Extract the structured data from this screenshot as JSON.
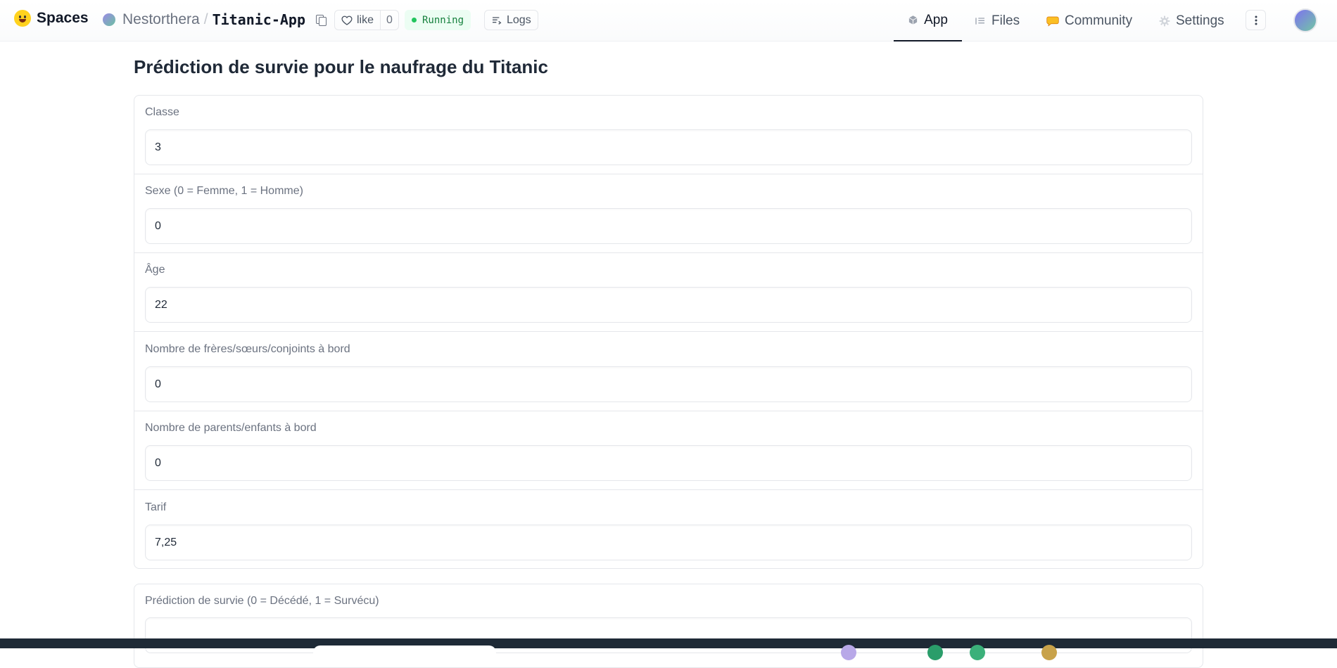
{
  "header": {
    "brand_label": "Spaces",
    "owner": "Nestorthera",
    "separator": "/",
    "repo": "Titanic-App",
    "like_label": "like",
    "like_count": "0",
    "status_label": "Running",
    "logs_label": "Logs",
    "tabs": [
      {
        "label": "App",
        "icon": "cube-icon",
        "active": true
      },
      {
        "label": "Files",
        "icon": "files-icon",
        "active": false
      },
      {
        "label": "Community",
        "icon": "community-icon",
        "active": false
      },
      {
        "label": "Settings",
        "icon": "gear-icon",
        "active": false
      }
    ]
  },
  "main": {
    "title": "Prédiction de survie pour le naufrage du Titanic",
    "fields": [
      {
        "label": "Classe",
        "value": "3"
      },
      {
        "label": "Sexe (0 = Femme, 1 = Homme)",
        "value": "0"
      },
      {
        "label": "Âge",
        "value": "22"
      },
      {
        "label": "Nombre de frères/sœurs/conjoints à bord",
        "value": "0"
      },
      {
        "label": "Nombre de parents/enfants à bord",
        "value": "0"
      },
      {
        "label": "Tarif",
        "value": "7,25"
      }
    ],
    "output": {
      "label": "Prédiction de survie (0 = Décédé, 1 = Survécu)",
      "value": ""
    }
  },
  "colors": {
    "running_bg": "#ecfdf3",
    "running_text": "#15803d",
    "accent_active_tab": "#111827",
    "taskbar": "#1e2a36"
  }
}
